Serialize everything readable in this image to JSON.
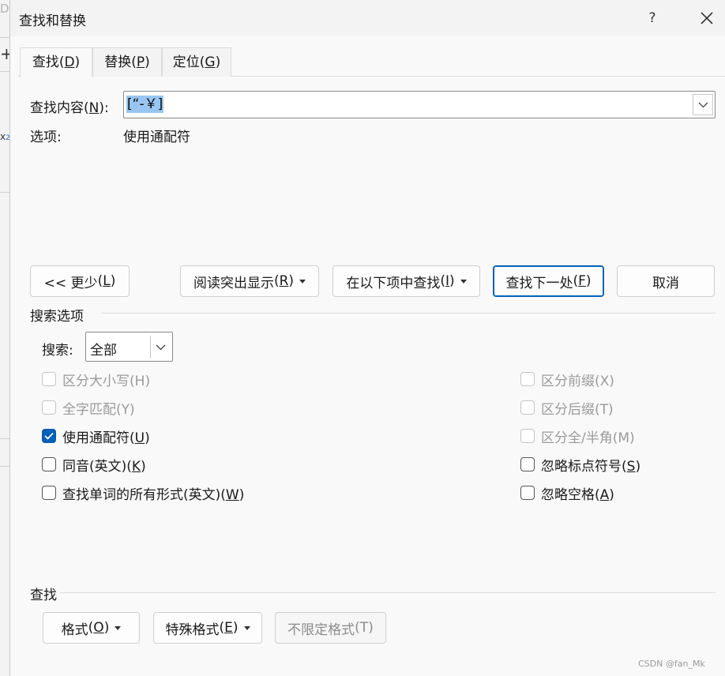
{
  "background_app": {
    "letter": "D",
    "plus": "+",
    "sub_main": "x",
    "sub_script": "2"
  },
  "window": {
    "title": "查找和替换",
    "help": "?"
  },
  "tabs": [
    {
      "label": "查找",
      "key": "D",
      "active": true
    },
    {
      "label": "替换",
      "key": "P",
      "active": false
    },
    {
      "label": "定位",
      "key": "G",
      "active": false
    }
  ],
  "find": {
    "label": "查找内容",
    "key": "N",
    "value": "[“-￥]",
    "options_label": "选项:",
    "options_value": "使用通配符"
  },
  "buttons": {
    "less": {
      "label": "<< 更少",
      "key": "L"
    },
    "reading_highlight": {
      "label": "阅读突出显示",
      "key": "R"
    },
    "find_in": {
      "label": "在以下项中查找",
      "key": "I"
    },
    "find_next": {
      "label": "查找下一处",
      "key": "F"
    },
    "cancel": "取消"
  },
  "search_options": {
    "title": "搜索选项",
    "search_label": "搜索:",
    "search_value": "全部",
    "left": [
      {
        "label": "区分大小写",
        "key": "H",
        "checked": false,
        "disabled": true
      },
      {
        "label": "全字匹配",
        "key": "Y",
        "checked": false,
        "disabled": true
      },
      {
        "label": "使用通配符",
        "key": "U",
        "checked": true,
        "disabled": false
      },
      {
        "label": "同音(英文)",
        "key": "K",
        "checked": false,
        "disabled": false
      },
      {
        "label": "查找单词的所有形式(英文)",
        "key": "W",
        "checked": false,
        "disabled": false
      }
    ],
    "right": [
      {
        "label": "区分前缀",
        "key": "X",
        "checked": false,
        "disabled": true
      },
      {
        "label": "区分后缀",
        "key": "T",
        "checked": false,
        "disabled": true
      },
      {
        "label": "区分全/半角",
        "key": "M",
        "checked": false,
        "disabled": true
      },
      {
        "label": "忽略标点符号",
        "key": "S",
        "checked": false,
        "disabled": false
      },
      {
        "label": "忽略空格",
        "key": "A",
        "checked": false,
        "disabled": false
      }
    ]
  },
  "find_section": {
    "title": "查找",
    "format": {
      "label": "格式",
      "key": "O"
    },
    "special": {
      "label": "特殊格式",
      "key": "E"
    },
    "no_format": {
      "label": "不限定格式",
      "key": "T"
    }
  },
  "watermark": "CSDN @fan_Mk",
  "colors": {
    "accent": "#005fb8",
    "selection": "#99c6f0",
    "dialog_bg": "#f9f9f9"
  }
}
